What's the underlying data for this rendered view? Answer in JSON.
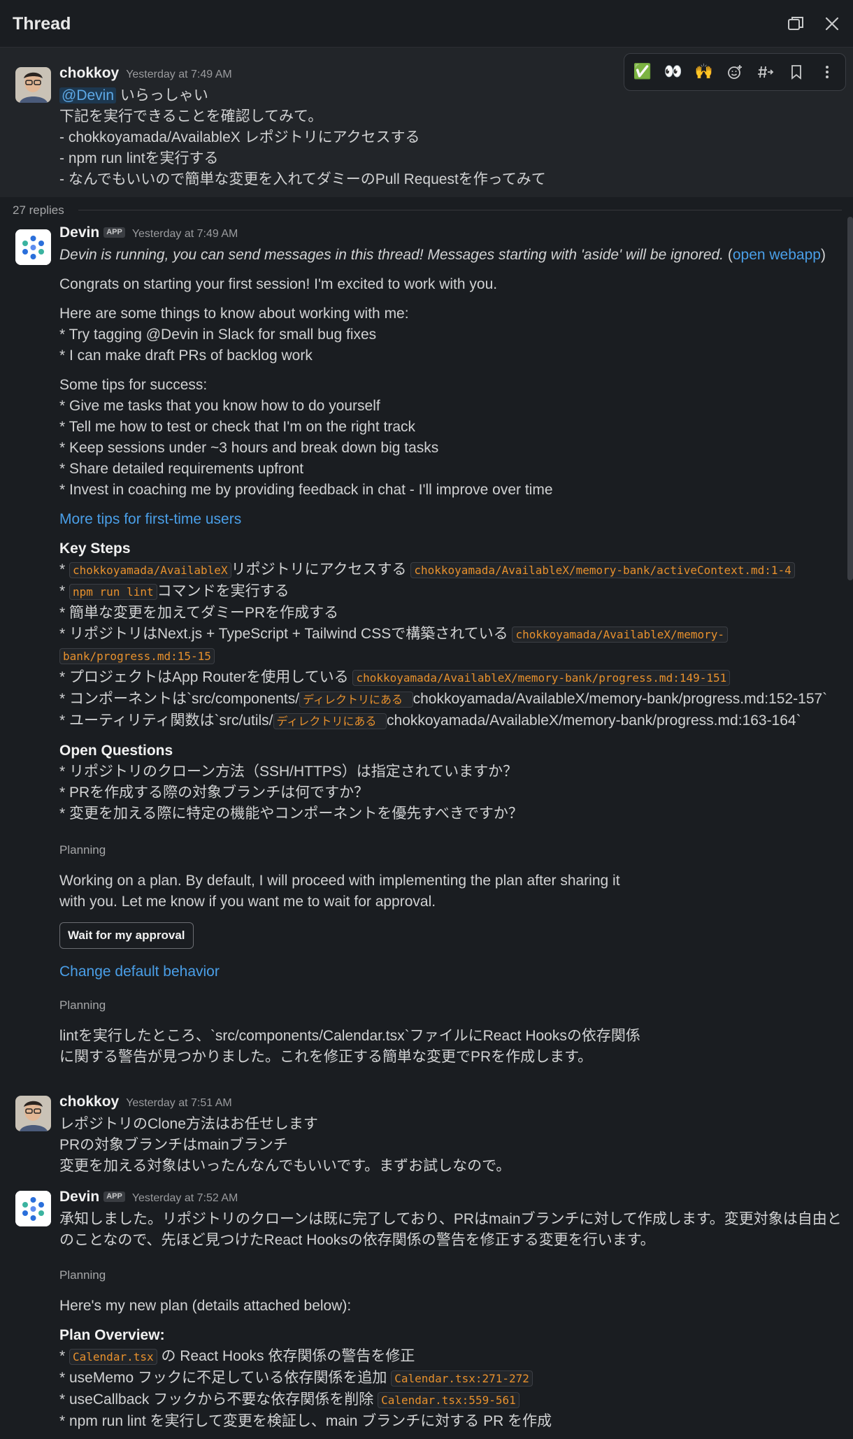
{
  "header": {
    "title": "Thread"
  },
  "toolbar": {
    "emojis": [
      "✅",
      "👀",
      "🙌"
    ]
  },
  "parent": {
    "author": "chokkoy",
    "time": "Yesterday at 7:49 AM",
    "mention": "@Devin",
    "line1_rest": "いらっしゃい",
    "lines": [
      "下記を実行できることを確認してみて。",
      "- chokkoyamada/AvailableX レポジトリにアクセスする",
      "- npm run lintを実行する",
      "- なんでもいいので簡単な変更を入れてダミーのPull Requestを作ってみて"
    ]
  },
  "replies": {
    "count_label": "27 replies"
  },
  "devin1": {
    "author": "Devin",
    "badge": "APP",
    "time": "Yesterday at 7:49 AM",
    "running": "Devin is running, you can send messages in this thread! Messages starting with 'aside' will be ignored.",
    "open_paren": " (",
    "open_webapp": "open webapp",
    "close_paren": ")",
    "congrats": "Congrats on starting your first session! I'm excited to work with you.",
    "things_intro": "Here are some things to know about working with me:",
    "things": [
      "* Try tagging @Devin in Slack for small bug fixes",
      "* I can make draft PRs of backlog work"
    ],
    "tips_intro": "Some tips for success:",
    "tips": [
      "* Give me tasks that you know how to do yourself",
      "* Tell me how to test or check that I'm on the right track",
      "* Keep sessions under ~3 hours and break down big tasks",
      "* Share detailed requirements upfront",
      "* Invest in coaching me by providing feedback in chat - I'll improve over time"
    ],
    "more_tips": "More tips for first-time users",
    "key_steps_title": "Key Steps",
    "ks1_code": "chokkoyamada/AvailableX",
    "ks1_text": "リポジトリにアクセスする",
    "ks1_ref": "chokkoyamada/AvailableX/memory-bank/activeContext.md:1-4",
    "ks2_code": "npm run lint",
    "ks2_text": "コマンドを実行する",
    "ks3_text": "* 簡単な変更を加えてダミーPRを作成する",
    "ks4_text": "* リポジトリはNext.js + TypeScript + Tailwind CSSで構築されている",
    "ks4_ref_a": "chokkoyamada/AvailableX/memory-",
    "ks4_ref_b": "bank/progress.md:15-15",
    "ks5_text": "* プロジェクトはApp Routerを使用している",
    "ks5_ref": "chokkoyamada/AvailableX/memory-bank/progress.md:149-151",
    "ks6_a": "* コンポーネントは`src/components/",
    "ks6_code": "ディレクトリにある ",
    "ks6_b": "chokkoyamada/AvailableX/memory-bank/progress.md:152-157`",
    "ks7_a": "* ユーティリティ関数は`src/utils/",
    "ks7_code": "ディレクトリにある ",
    "ks7_b": "chokkoyamada/AvailableX/memory-bank/progress.md:163-164`",
    "oq_title": "Open Questions",
    "oq": [
      "* リポジトリのクローン方法（SSH/HTTPS）は指定されていますか？",
      "* PRを作成する際の対象ブランチは何ですか？",
      "* 変更を加える際に特定の機能やコンポーネントを優先すべきですか？"
    ],
    "planning1": "Planning",
    "plan_text1": "Working on a plan. By default, I will proceed with implementing the plan after sharing it",
    "plan_text2": "with you. Let me know if you want me to wait for approval.",
    "approval_button": "Wait for my approval",
    "change_default": "Change default behavior",
    "planning2": "Planning",
    "lint_text1": "lintを実行したところ、`src/components/Calendar.tsx`ファイルにReact Hooksの依存関係",
    "lint_text2": "に関する警告が見つかりました。これを修正する簡単な変更でPRを作成します。"
  },
  "chokkoy2": {
    "author": "chokkoy",
    "time": "Yesterday at 7:51 AM",
    "lines": [
      "レポジトリのClone方法はお任せします",
      "PRの対象ブランチはmainブランチ",
      "変更を加える対象はいったんなんでもいいです。まずお試しなので。"
    ]
  },
  "devin2": {
    "author": "Devin",
    "badge": "APP",
    "time": "Yesterday at 7:52 AM",
    "ack1": "承知しました。リポジトリのクローンは既に完了しており、PRはmainブランチに対して作成します。変更対象は自由と",
    "ack2": "のことなので、先ほど見つけたReact Hooksの依存関係の警告を修正する変更を行います。",
    "planning": "Planning",
    "new_plan": "Here's my new plan (details attached below):",
    "overview_title": "Plan Overview:",
    "po1_code": "Calendar.tsx",
    "po1_text": " の React Hooks 依存関係の警告を修正",
    "po2_text": "* useMemo フックに不足している依存関係を追加",
    "po2_ref": "Calendar.tsx:271-272",
    "po3_text": "* useCallback フックから不要な依存関係を削除",
    "po3_ref": "Calendar.tsx:559-561",
    "po4_text": "* npm run lint を実行して変更を検証し、main ブランチに対する PR を作成"
  }
}
